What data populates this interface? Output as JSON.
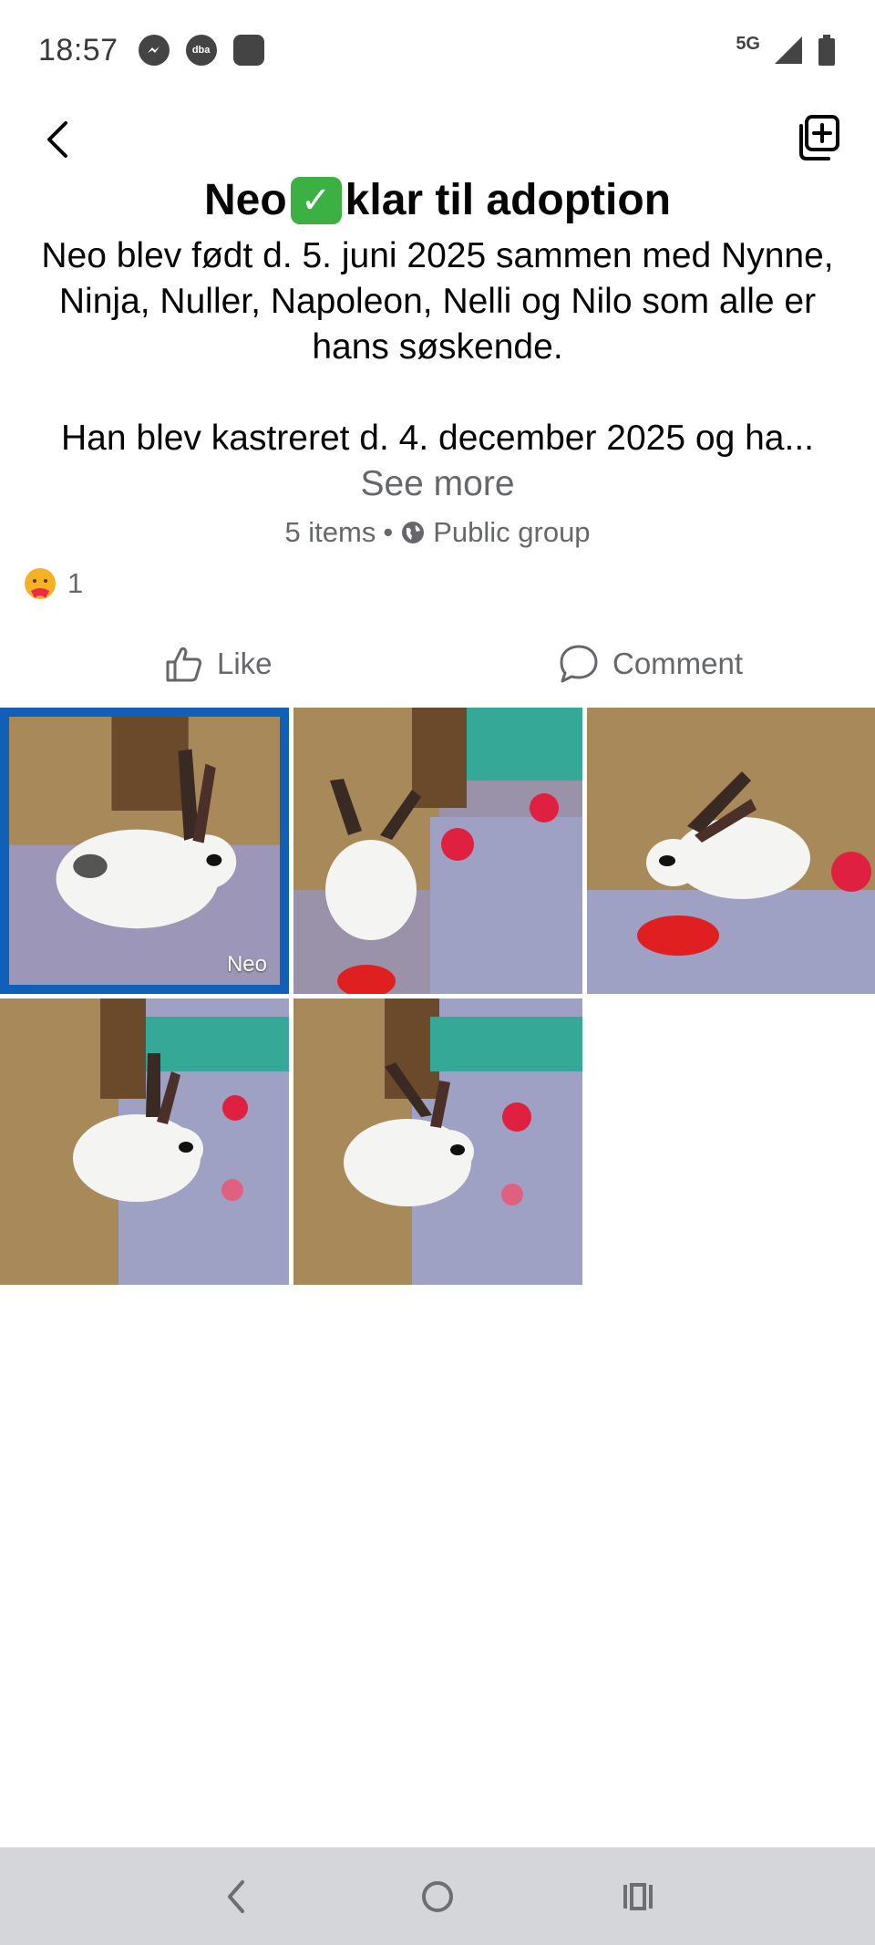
{
  "status_bar": {
    "time": "18:57",
    "network": "5G",
    "notification_icons": [
      "messenger-icon",
      "dba-icon",
      "app-icon"
    ],
    "dba_label": "dba"
  },
  "post": {
    "title_before": "Neo",
    "title_emoji": "✓",
    "title_after": "klar til adoption",
    "body_line1": "Neo blev født d. 5. juni 2025 sammen med Nynne, Ninja, Nuller, Napoleon, Nelli og Nilo som alle er hans søskende.",
    "body_line2": "Han blev kastreret d. 4. december 2025 og ha...",
    "see_more": "See more",
    "items_count": "5 items",
    "separator": "•",
    "visibility": "Public group",
    "reaction_count": "1"
  },
  "actions": {
    "like": "Like",
    "comment": "Comment"
  },
  "photos": [
    {
      "caption": "Neo",
      "selected": true
    },
    {
      "caption": ""
    },
    {
      "caption": ""
    },
    {
      "caption": ""
    },
    {
      "caption": ""
    }
  ],
  "colors": {
    "selected_border": "#1160b8",
    "secondary_text": "#65676b",
    "nav_bar": "#d5d6d9"
  }
}
